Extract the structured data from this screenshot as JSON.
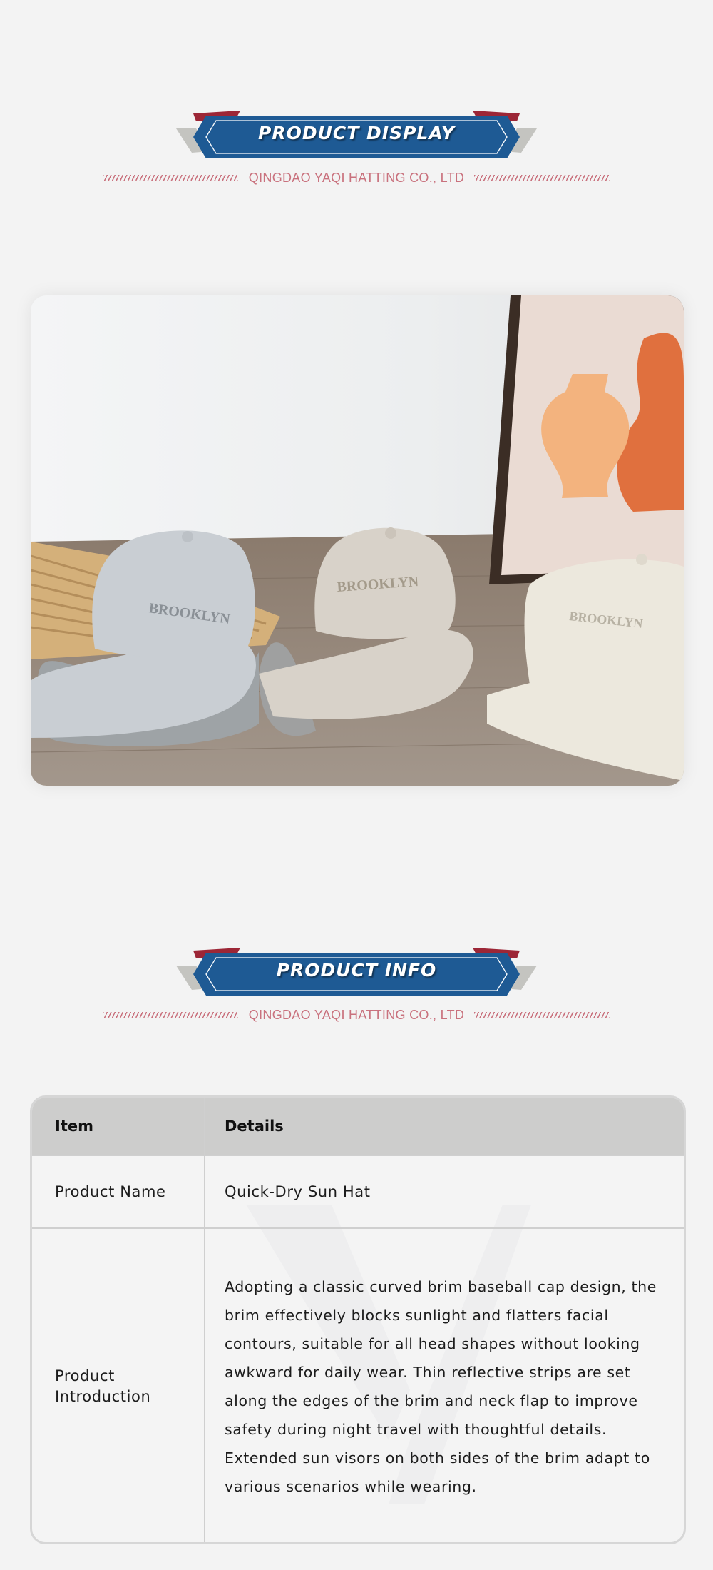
{
  "display_section": {
    "title": "PRODUCT DISPLAY",
    "company": "QINGDAO YAQI HATTING CO., LTD"
  },
  "product_image": {
    "caps": [
      {
        "label": "BROOKLYN",
        "color": "#c9ced3"
      },
      {
        "label": "BROOKLYN",
        "color": "#d8d2c9"
      },
      {
        "label": "BROOKLYN",
        "color": "#ece8dd"
      }
    ]
  },
  "info_section": {
    "title": "PRODUCT INFO",
    "company": "QINGDAO YAQI HATTING CO., LTD"
  },
  "table": {
    "headers": [
      "Item",
      "Details"
    ],
    "rows": [
      {
        "item": "Product Name",
        "details": "Quick-Dry Sun Hat"
      },
      {
        "item": "Product Introduction",
        "details": "Adopting a classic curved brim baseball cap design, the brim effectively blocks sunlight and flatters facial contours, suitable for all head shapes without looking awkward for daily wear. Thin reflective strips are set along the edges of the brim and neck flap to improve safety during night travel with thoughtful details. Extended sun visors on both sides of the brim adapt to various scenarios while wearing."
      }
    ]
  },
  "colors": {
    "banner_blue": "#1e5a94",
    "banner_red": "#9c2636",
    "banner_gray": "#c4c4c0",
    "accent_pink": "#c9717d",
    "background": "#f3f3f3"
  }
}
